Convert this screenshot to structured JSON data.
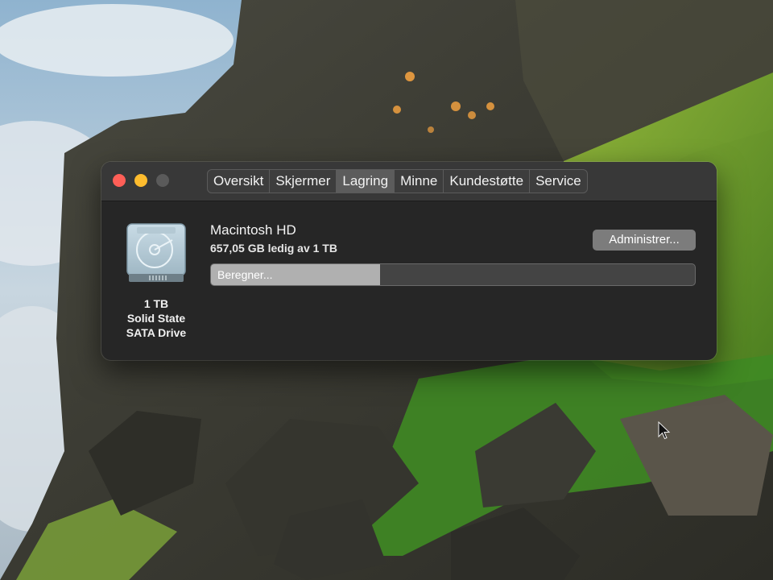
{
  "window": {
    "tabs": [
      {
        "label": "Oversikt",
        "active": false
      },
      {
        "label": "Skjermer",
        "active": false
      },
      {
        "label": "Lagring",
        "active": true
      },
      {
        "label": "Minne",
        "active": false
      },
      {
        "label": "Kundestøtte",
        "active": false
      },
      {
        "label": "Service",
        "active": false
      }
    ]
  },
  "storage": {
    "drive_caption": [
      "1 TB",
      "Solid State",
      "SATA Drive"
    ],
    "disk_name": "Macintosh HD",
    "free_space": "657,05 GB ledig av 1 TB",
    "manage_label": "Administrer...",
    "bar_label": "Beregner...",
    "bar_progress": 0.35
  },
  "colors": {
    "close": "#ff5f57",
    "minimize": "#febc2e",
    "zoom_disabled": "#5a5a5a",
    "window_bg": "#262626",
    "titlebar_bg": "#383838"
  },
  "icons": [
    "hard-drive-icon",
    "pointer-cursor-icon"
  ]
}
